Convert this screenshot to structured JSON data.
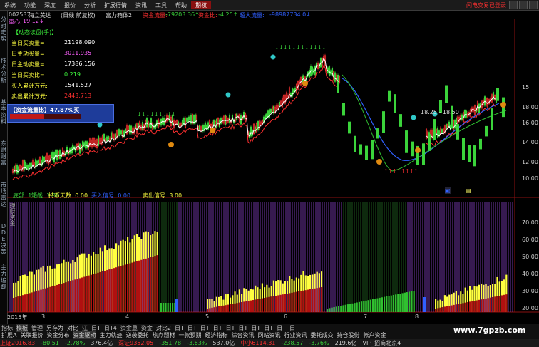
{
  "menu": {
    "items": [
      "系统",
      "功能",
      "深度",
      "报价",
      "分析",
      "扩展行情",
      "资讯",
      "工具",
      "帮助",
      "期权"
    ],
    "active_index": 9,
    "alert": "闪电交易已登录"
  },
  "sidebar": {
    "tabs": [
      "分时走势",
      "技术分析",
      "基本资料",
      "东财财富",
      "市场雷达",
      "DDE决策",
      "主力追踪"
    ]
  },
  "header": {
    "code": "002537",
    "name": "海立美达",
    "adjust": "(日线 前复权)",
    "indicator": "富力箱体2",
    "fund_flow_label": "资金流量:",
    "fund_flow_value": "-79203.36↑",
    "fund_ratio_label": "资金比:",
    "fund_ratio_value": "-4.25↑",
    "extra_label": "超大流量:",
    "extra_value": "-98987734.0↓",
    "focus_label": "重心:",
    "focus_value": "19.12↓"
  },
  "info_panel": {
    "title": "【动态读盘(手)】",
    "rows": [
      {
        "label": "当日买卖量=",
        "value": "21198.090",
        "color": "#ffffff"
      },
      {
        "label": "日主动买量=",
        "value": "3011.935",
        "color": "#ff60ff"
      },
      {
        "label": "日主动卖量=",
        "value": "17386.156",
        "color": "#ffffff"
      },
      {
        "label": "当日买卖比=",
        "value": "0.219",
        "color": "#40ff40"
      },
      {
        "label": "买入累计万元:",
        "value": "1541.527",
        "color": "#ffffff"
      },
      {
        "label": "卖出累计万元:",
        "value": "2443.713",
        "color": "#ff3030"
      }
    ]
  },
  "flow_box": {
    "label": "【资金流量比】47.87%买"
  },
  "price_axis": {
    "ticks": [
      "15",
      "18.00",
      "16.00",
      "14.00",
      "12.00",
      "10.00"
    ],
    "range": "18.25 - 18.50"
  },
  "signal_bar": {
    "items": [
      "底部: 1.00",
      "短线: 1.00",
      "持币天数: 0.00",
      "买入信号: 0.00",
      "卖出信号: 3.00"
    ]
  },
  "volume_axis": {
    "ticks": [
      "70.00",
      "60.00",
      "50.00",
      "40.00",
      "30.00",
      "20.00"
    ],
    "label": "理财资金"
  },
  "date_axis": {
    "labels": [
      "2015年",
      "3",
      "4",
      "5",
      "6",
      "7",
      "8"
    ]
  },
  "bottom_tabs_row1": [
    "指标",
    "模板",
    "管理",
    "另存为",
    "对比",
    "江",
    "日T",
    "日T4",
    "资金显",
    "资金",
    "对比2",
    "日T",
    "日T",
    "日T",
    "日T",
    "日T",
    "日T",
    "日T",
    "日T",
    "日T",
    "日T"
  ],
  "bottom_tabs_row2": [
    "扩展A",
    "关联报价",
    "资金分布",
    "资金驱动",
    "主力轨迹",
    "逆袭委托",
    "热点题材",
    "一款预期",
    "经济指标",
    "综合资讯",
    "网站资讯",
    "行业资讯",
    "委托成交",
    "持仓股份",
    "帐户资金"
  ],
  "status_bar": {
    "items": [
      {
        "text": "上证2016.83",
        "color": "#ff3030"
      },
      {
        "text": "-80.51",
        "color": "#3bd43b"
      },
      {
        "text": "-2.78%",
        "color": "#3bd43b"
      },
      {
        "text": "376.4亿",
        "color": "#ccc"
      },
      {
        "text": "深证9352.05",
        "color": "#ff3030"
      },
      {
        "text": "-351.78",
        "color": "#3bd43b"
      },
      {
        "text": "-3.63%",
        "color": "#3bd43b"
      },
      {
        "text": "537.0亿",
        "color": "#ccc"
      },
      {
        "text": "中小6114.31",
        "color": "#ff3030"
      },
      {
        "text": "-238.57",
        "color": "#3bd43b"
      },
      {
        "text": "-3.76%",
        "color": "#3bd43b"
      },
      {
        "text": "219.6亿",
        "color": "#ccc"
      },
      {
        "text": "VIP_招商北京4",
        "color": "#ccc"
      }
    ],
    "watermark": "www.7gpzb.com"
  },
  "colors": {
    "up": "#ff3030",
    "down": "#3bd43b",
    "ma_yellow": "#ffff40",
    "ma_white": "#ffffff",
    "ma_red": "#ff3030",
    "ma_blue": "#3060ff",
    "purple": "#8a40c8",
    "dark_red": "#b01010",
    "cyan": "#30c8c8"
  }
}
